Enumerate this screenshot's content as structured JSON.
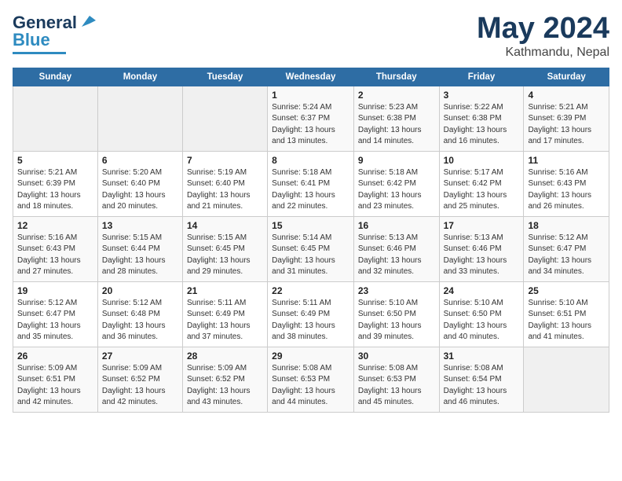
{
  "logo": {
    "text_general": "General",
    "text_blue": "Blue"
  },
  "title": {
    "month_year": "May 2024",
    "location": "Kathmandu, Nepal"
  },
  "weekdays": [
    "Sunday",
    "Monday",
    "Tuesday",
    "Wednesday",
    "Thursday",
    "Friday",
    "Saturday"
  ],
  "weeks": [
    [
      {
        "day": "",
        "info": ""
      },
      {
        "day": "",
        "info": ""
      },
      {
        "day": "",
        "info": ""
      },
      {
        "day": "1",
        "info": "Sunrise: 5:24 AM\nSunset: 6:37 PM\nDaylight: 13 hours\nand 13 minutes."
      },
      {
        "day": "2",
        "info": "Sunrise: 5:23 AM\nSunset: 6:38 PM\nDaylight: 13 hours\nand 14 minutes."
      },
      {
        "day": "3",
        "info": "Sunrise: 5:22 AM\nSunset: 6:38 PM\nDaylight: 13 hours\nand 16 minutes."
      },
      {
        "day": "4",
        "info": "Sunrise: 5:21 AM\nSunset: 6:39 PM\nDaylight: 13 hours\nand 17 minutes."
      }
    ],
    [
      {
        "day": "5",
        "info": "Sunrise: 5:21 AM\nSunset: 6:39 PM\nDaylight: 13 hours\nand 18 minutes."
      },
      {
        "day": "6",
        "info": "Sunrise: 5:20 AM\nSunset: 6:40 PM\nDaylight: 13 hours\nand 20 minutes."
      },
      {
        "day": "7",
        "info": "Sunrise: 5:19 AM\nSunset: 6:40 PM\nDaylight: 13 hours\nand 21 minutes."
      },
      {
        "day": "8",
        "info": "Sunrise: 5:18 AM\nSunset: 6:41 PM\nDaylight: 13 hours\nand 22 minutes."
      },
      {
        "day": "9",
        "info": "Sunrise: 5:18 AM\nSunset: 6:42 PM\nDaylight: 13 hours\nand 23 minutes."
      },
      {
        "day": "10",
        "info": "Sunrise: 5:17 AM\nSunset: 6:42 PM\nDaylight: 13 hours\nand 25 minutes."
      },
      {
        "day": "11",
        "info": "Sunrise: 5:16 AM\nSunset: 6:43 PM\nDaylight: 13 hours\nand 26 minutes."
      }
    ],
    [
      {
        "day": "12",
        "info": "Sunrise: 5:16 AM\nSunset: 6:43 PM\nDaylight: 13 hours\nand 27 minutes."
      },
      {
        "day": "13",
        "info": "Sunrise: 5:15 AM\nSunset: 6:44 PM\nDaylight: 13 hours\nand 28 minutes."
      },
      {
        "day": "14",
        "info": "Sunrise: 5:15 AM\nSunset: 6:45 PM\nDaylight: 13 hours\nand 29 minutes."
      },
      {
        "day": "15",
        "info": "Sunrise: 5:14 AM\nSunset: 6:45 PM\nDaylight: 13 hours\nand 31 minutes."
      },
      {
        "day": "16",
        "info": "Sunrise: 5:13 AM\nSunset: 6:46 PM\nDaylight: 13 hours\nand 32 minutes."
      },
      {
        "day": "17",
        "info": "Sunrise: 5:13 AM\nSunset: 6:46 PM\nDaylight: 13 hours\nand 33 minutes."
      },
      {
        "day": "18",
        "info": "Sunrise: 5:12 AM\nSunset: 6:47 PM\nDaylight: 13 hours\nand 34 minutes."
      }
    ],
    [
      {
        "day": "19",
        "info": "Sunrise: 5:12 AM\nSunset: 6:47 PM\nDaylight: 13 hours\nand 35 minutes."
      },
      {
        "day": "20",
        "info": "Sunrise: 5:12 AM\nSunset: 6:48 PM\nDaylight: 13 hours\nand 36 minutes."
      },
      {
        "day": "21",
        "info": "Sunrise: 5:11 AM\nSunset: 6:49 PM\nDaylight: 13 hours\nand 37 minutes."
      },
      {
        "day": "22",
        "info": "Sunrise: 5:11 AM\nSunset: 6:49 PM\nDaylight: 13 hours\nand 38 minutes."
      },
      {
        "day": "23",
        "info": "Sunrise: 5:10 AM\nSunset: 6:50 PM\nDaylight: 13 hours\nand 39 minutes."
      },
      {
        "day": "24",
        "info": "Sunrise: 5:10 AM\nSunset: 6:50 PM\nDaylight: 13 hours\nand 40 minutes."
      },
      {
        "day": "25",
        "info": "Sunrise: 5:10 AM\nSunset: 6:51 PM\nDaylight: 13 hours\nand 41 minutes."
      }
    ],
    [
      {
        "day": "26",
        "info": "Sunrise: 5:09 AM\nSunset: 6:51 PM\nDaylight: 13 hours\nand 42 minutes."
      },
      {
        "day": "27",
        "info": "Sunrise: 5:09 AM\nSunset: 6:52 PM\nDaylight: 13 hours\nand 42 minutes."
      },
      {
        "day": "28",
        "info": "Sunrise: 5:09 AM\nSunset: 6:52 PM\nDaylight: 13 hours\nand 43 minutes."
      },
      {
        "day": "29",
        "info": "Sunrise: 5:08 AM\nSunset: 6:53 PM\nDaylight: 13 hours\nand 44 minutes."
      },
      {
        "day": "30",
        "info": "Sunrise: 5:08 AM\nSunset: 6:53 PM\nDaylight: 13 hours\nand 45 minutes."
      },
      {
        "day": "31",
        "info": "Sunrise: 5:08 AM\nSunset: 6:54 PM\nDaylight: 13 hours\nand 46 minutes."
      },
      {
        "day": "",
        "info": ""
      }
    ]
  ]
}
